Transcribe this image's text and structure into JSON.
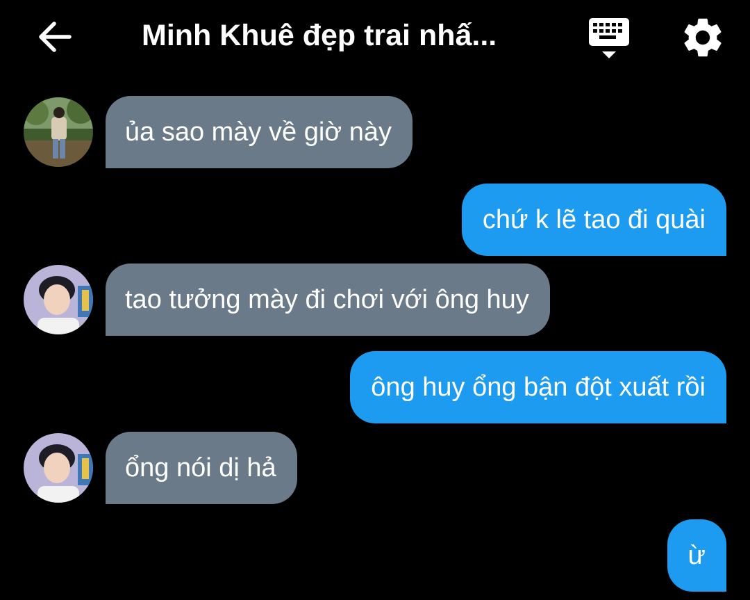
{
  "header": {
    "back_icon": "arrow-left-icon",
    "title": "Minh Khuê đẹp trai nhấ...",
    "keyboard_icon": "keyboard-icon",
    "settings_icon": "gear-icon"
  },
  "colors": {
    "background": "#000000",
    "incoming_bubble": "#6a7a88",
    "outgoing_bubble": "#1d9bf0",
    "text": "#ffffff"
  },
  "messages": [
    {
      "direction": "incoming",
      "text": "ủa sao mày về giờ này",
      "avatar": "avatar-outdoor"
    },
    {
      "direction": "outgoing",
      "text": "chứ k lẽ tao đi quài"
    },
    {
      "direction": "incoming",
      "text": "tao tưởng mày đi chơi với ông huy",
      "avatar": "avatar-selfie"
    },
    {
      "direction": "outgoing",
      "text": "ông huy ổng bận đột xuất rồi"
    },
    {
      "direction": "incoming",
      "text": "ổng nói dị hả",
      "avatar": "avatar-selfie"
    },
    {
      "direction": "outgoing",
      "text": "ừ"
    }
  ]
}
